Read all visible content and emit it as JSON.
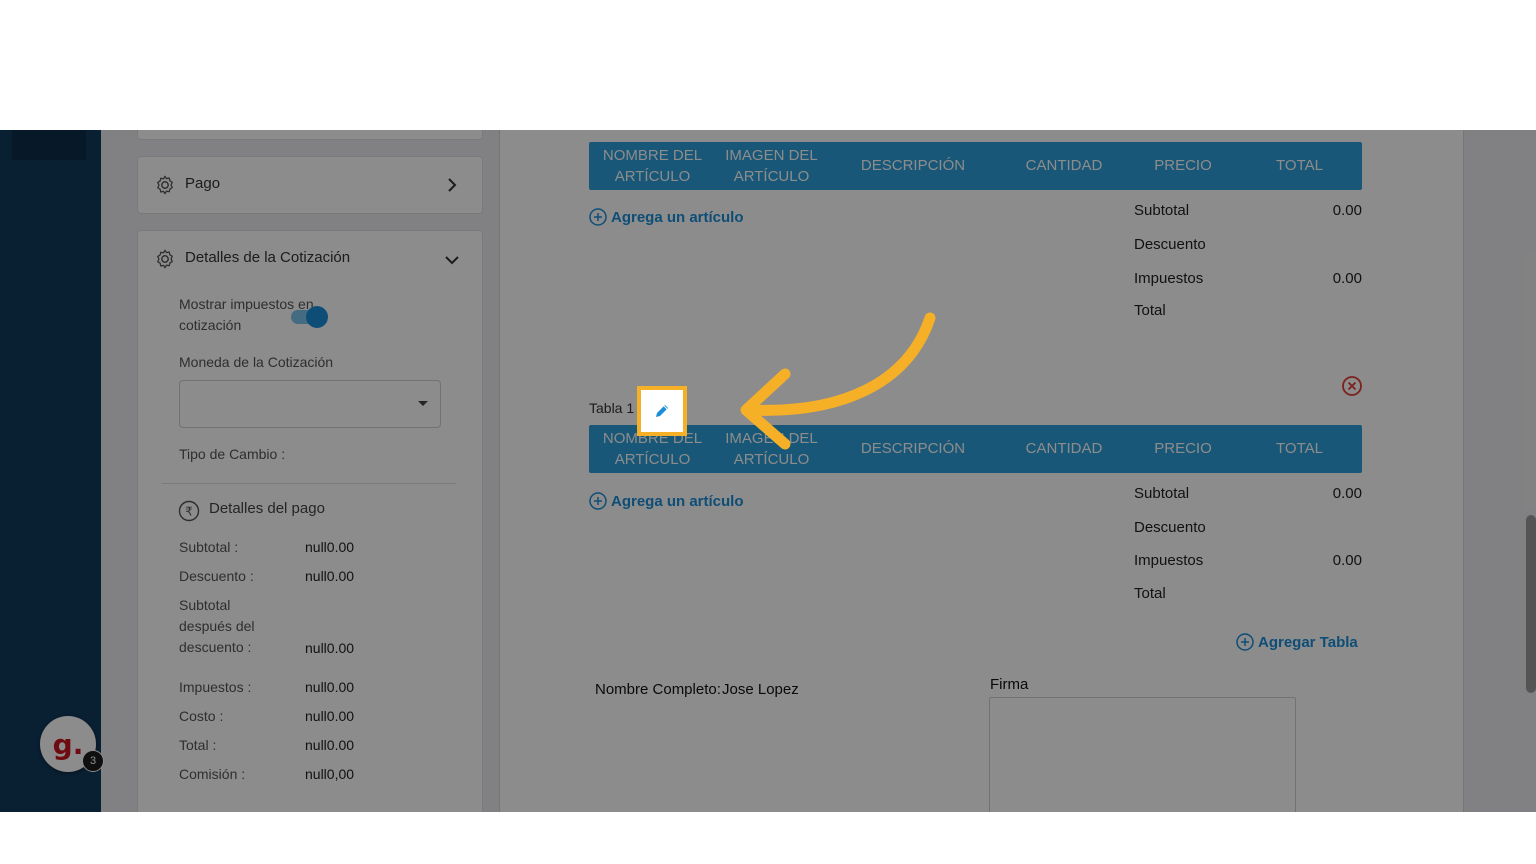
{
  "sidebar_panel": {
    "pago_title": "Pago",
    "detalles_title": "Detalles de la Cotización",
    "mostrar_impuestos_label": "Mostrar impuestos en cotización",
    "mostrar_impuestos_on": true,
    "moneda_label": "Moneda de la Cotización",
    "moneda_value": "",
    "tipo_cambio_label": "Tipo de Cambio :",
    "pago_detalles_title": "Detalles del pago",
    "rows": [
      {
        "label": "Subtotal :",
        "value": "null0.00"
      },
      {
        "label": "Descuento :",
        "value": "null0.00"
      },
      {
        "label": "Subtotal después del descuento :",
        "value": "null0.00"
      },
      {
        "label": "Impuestos :",
        "value": "null0.00"
      },
      {
        "label": "Costo :",
        "value": "null0.00"
      },
      {
        "label": "Total :",
        "value": "null0.00"
      },
      {
        "label": "Comisión :",
        "value": "null0,00"
      }
    ]
  },
  "avatar": {
    "letter": "g.",
    "badge": "3"
  },
  "table_headers": [
    "NOMBRE DEL ARTÍCULO",
    "IMAGEN DEL ARTÍCULO",
    "DESCRIPCIÓN",
    "CANTIDAD",
    "PRECIO",
    "TOTAL"
  ],
  "tables": [
    {
      "add_item": "Agrega un artículo",
      "totals": [
        {
          "label": "Subtotal",
          "value": "0.00"
        },
        {
          "label": "Descuento",
          "value": ""
        },
        {
          "label": "Impuestos",
          "value": "0.00"
        },
        {
          "label": "Total",
          "value": ""
        }
      ]
    },
    {
      "name": "Tabla 1",
      "add_item": "Agrega un artículo",
      "totals": [
        {
          "label": "Subtotal",
          "value": "0.00"
        },
        {
          "label": "Descuento",
          "value": ""
        },
        {
          "label": "Impuestos",
          "value": "0.00"
        },
        {
          "label": "Total",
          "value": ""
        }
      ]
    }
  ],
  "add_table": "Agregar Tabla",
  "signature": {
    "name_label": "Nombre Completo:",
    "name_value": "Jose Lopez",
    "firma_label": "Firma"
  },
  "colors": {
    "accent": "#2d9fd9",
    "highlight": "#f5b027",
    "navbar": "#123a5c",
    "delete": "#e53935"
  }
}
